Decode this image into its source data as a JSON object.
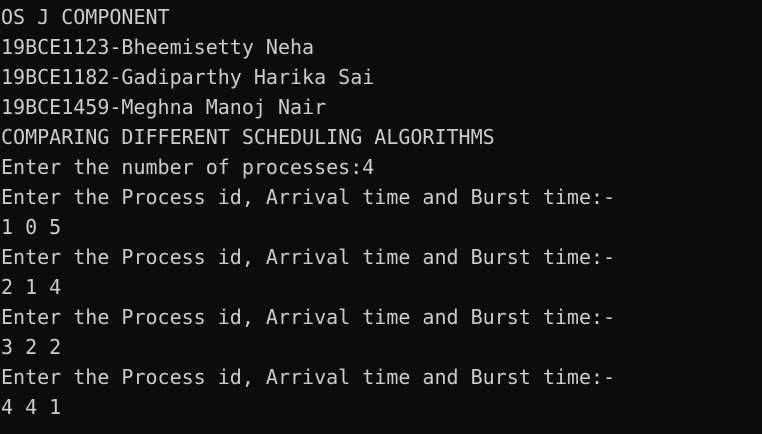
{
  "console": {
    "lines": [
      "OS J COMPONENT",
      "19BCE1123-Bheemisetty Neha",
      "19BCE1182-Gadiparthy Harika Sai",
      "19BCE1459-Meghna Manoj Nair",
      "COMPARING DIFFERENT SCHEDULING ALGORITHMS",
      "Enter the number of processes:4",
      "Enter the Process id, Arrival time and Burst time:-",
      "1 0 5",
      "Enter the Process id, Arrival time and Burst time:-",
      "2 1 4",
      "Enter the Process id, Arrival time and Burst time:-",
      "3 2 2",
      "Enter the Process id, Arrival time and Burst time:-",
      "4 4 1"
    ]
  },
  "colors": {
    "background": "#0c0c0c",
    "text": "#cccccc"
  }
}
